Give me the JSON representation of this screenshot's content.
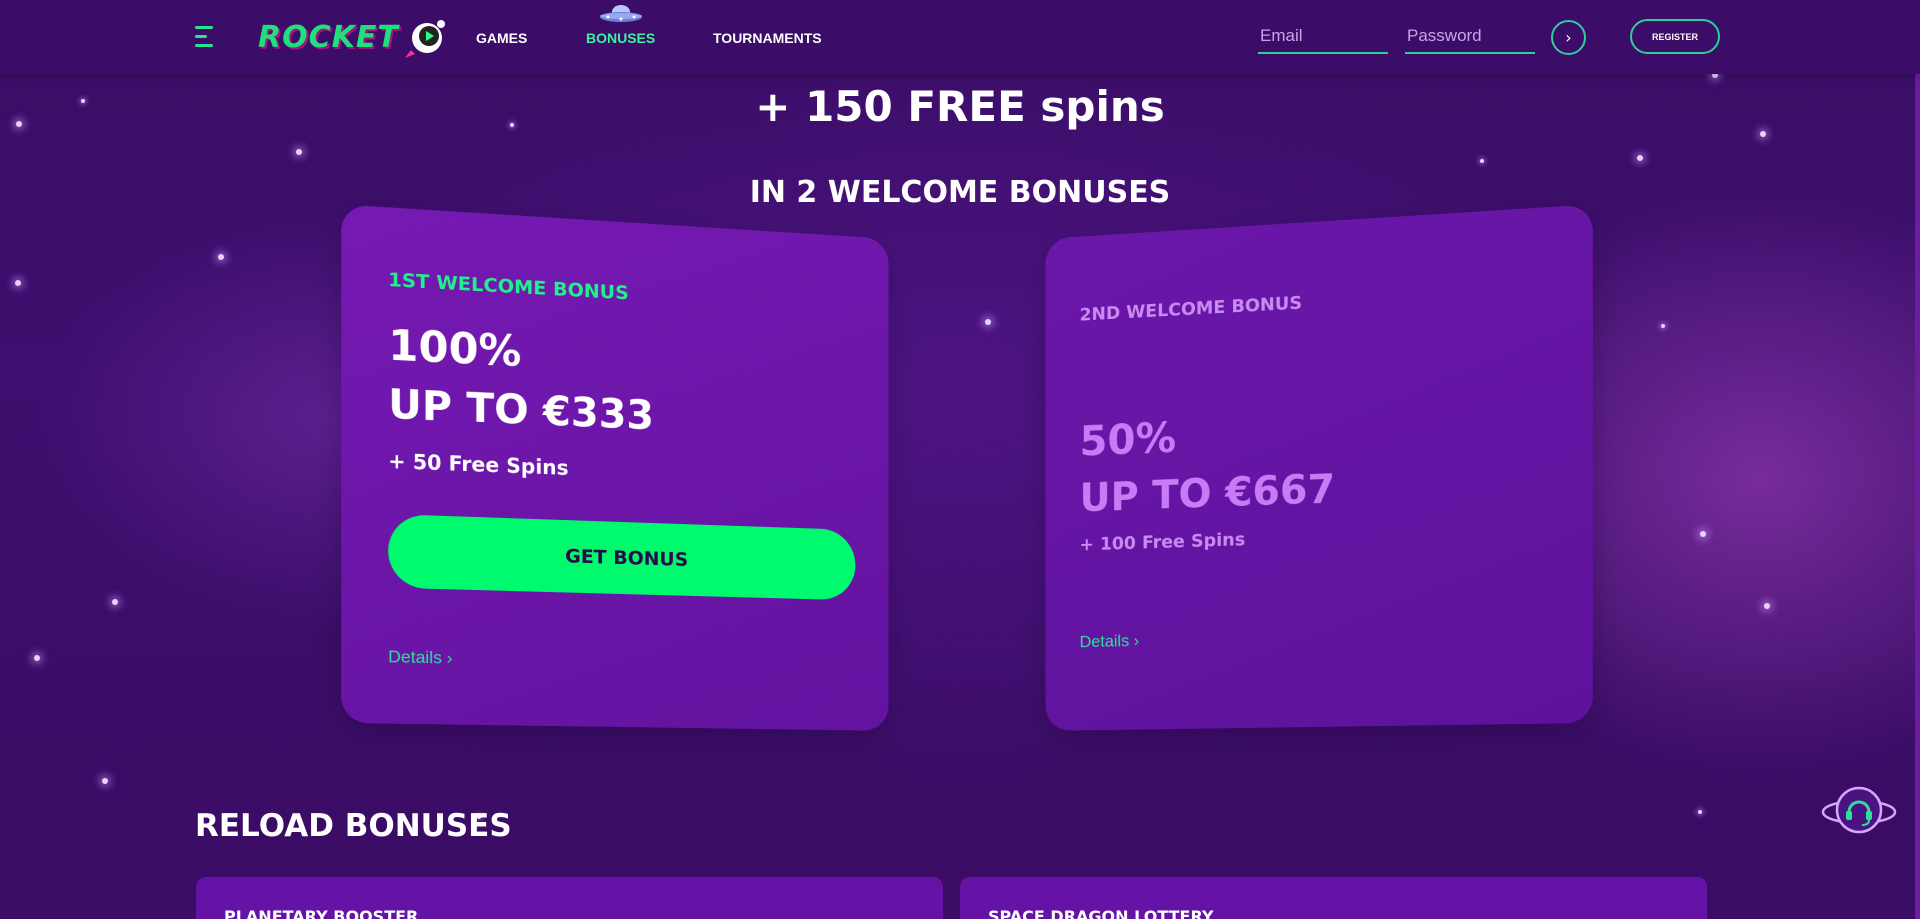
{
  "header": {
    "logo_text": "ROCKET",
    "nav": {
      "games": "GAMES",
      "bonuses": "BONUSES",
      "tournaments": "TOURNAMENTS"
    },
    "email_placeholder": "Email",
    "password_placeholder": "Password",
    "go_glyph": "›",
    "register_label": "REGISTER"
  },
  "hero": {
    "title": "+ 150 FREE spins",
    "subtitle": "IN 2 WELCOME BONUSES"
  },
  "welcome_bonuses": [
    {
      "label": "1ST WELCOME BONUS",
      "percent": "100%",
      "up_to": "UP TO €333",
      "spins": "+ 50 Free Spins",
      "cta": "GET BONUS",
      "details": "Details ›"
    },
    {
      "label": "2ND WELCOME BONUS",
      "percent": "50%",
      "up_to": "UP TO €667",
      "spins": "+ 100 Free Spins",
      "details": "Details ›"
    }
  ],
  "reload": {
    "title": "RELOAD BONUSES",
    "cards": [
      {
        "title": "PLANETARY BOOSTER"
      },
      {
        "title": "SPACE DRAGON LOTTERY"
      }
    ]
  },
  "icons": {
    "menu": "hamburger-menu-icon",
    "support": "support-headset-icon",
    "ufo": "ufo-icon"
  },
  "colors": {
    "background": "#3b0c68",
    "accent_green": "#00fa6e",
    "card_purple": "#6a16a8",
    "muted_purple_text": "#c77cf5"
  }
}
